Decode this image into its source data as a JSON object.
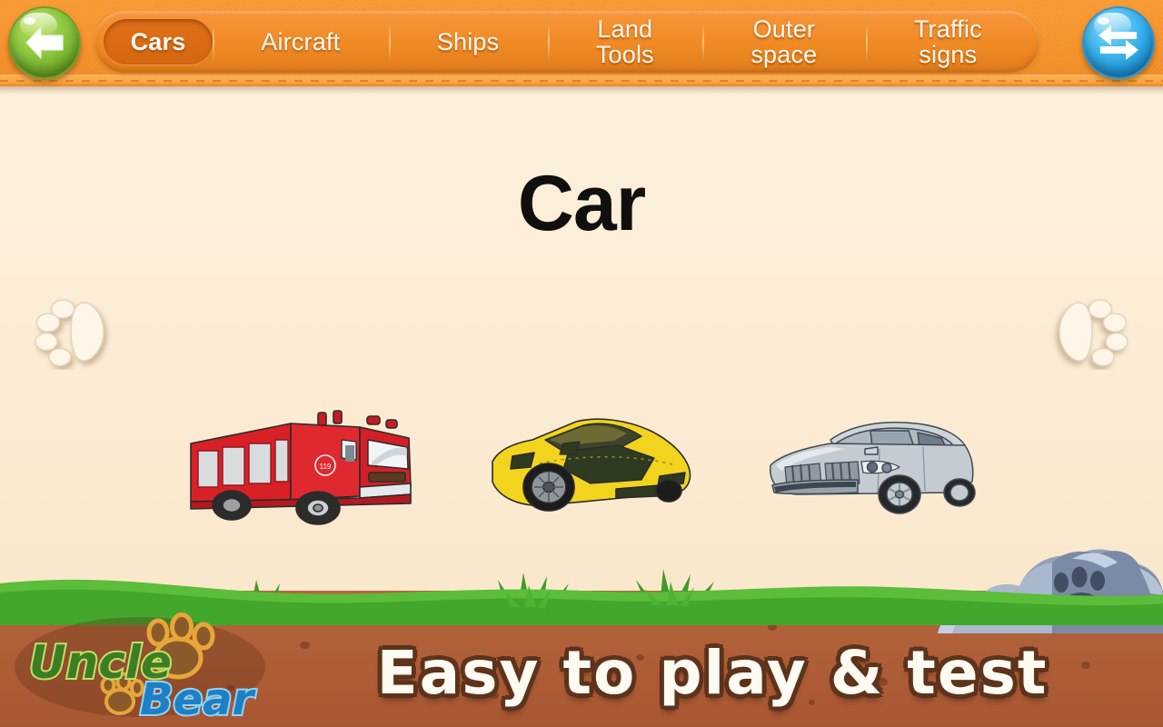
{
  "header": {
    "back_button": {
      "name": "back-button",
      "icon": "arrow-left-icon",
      "color": "#8cc63f"
    },
    "swap_button": {
      "name": "swap-button",
      "icon": "swap-arrows-icon",
      "color": "#3bb4ee"
    },
    "tabs": [
      {
        "label": "Cars",
        "active": true
      },
      {
        "label": "Aircraft",
        "active": false
      },
      {
        "label": "Ships",
        "active": false
      },
      {
        "label": "Land\nTools",
        "active": false
      },
      {
        "label": "Outer\nspace",
        "active": false
      },
      {
        "label": "Traffic\nsigns",
        "active": false
      }
    ]
  },
  "main": {
    "title": "Car",
    "prev_icon": "paw-print-left-icon",
    "next_icon": "paw-print-right-icon",
    "vehicles": [
      {
        "name": "fire-truck",
        "label": "Fire Truck",
        "color": "#d92027"
      },
      {
        "name": "sports-car",
        "label": "Sports Car",
        "color": "#f2d41f"
      },
      {
        "name": "sedan",
        "label": "Sedan",
        "color": "#c8ccd0"
      }
    ]
  },
  "footer": {
    "logo_word_one": "Uncle",
    "logo_word_two": "Bear",
    "tagline": "Easy to play & test",
    "rock_icon": "paw-print-rock-icon"
  },
  "colors": {
    "header_orange": "#f6922b",
    "tab_active": "#d4670f",
    "stage_cream": "#fbead0",
    "grass_green": "#4caf30",
    "dirt_brown": "#b06038",
    "logo_green": "#3f7d23",
    "logo_blue": "#1f7fc4",
    "paw_orange": "#e0a22c",
    "rock_blue": "#7b8aa5"
  }
}
